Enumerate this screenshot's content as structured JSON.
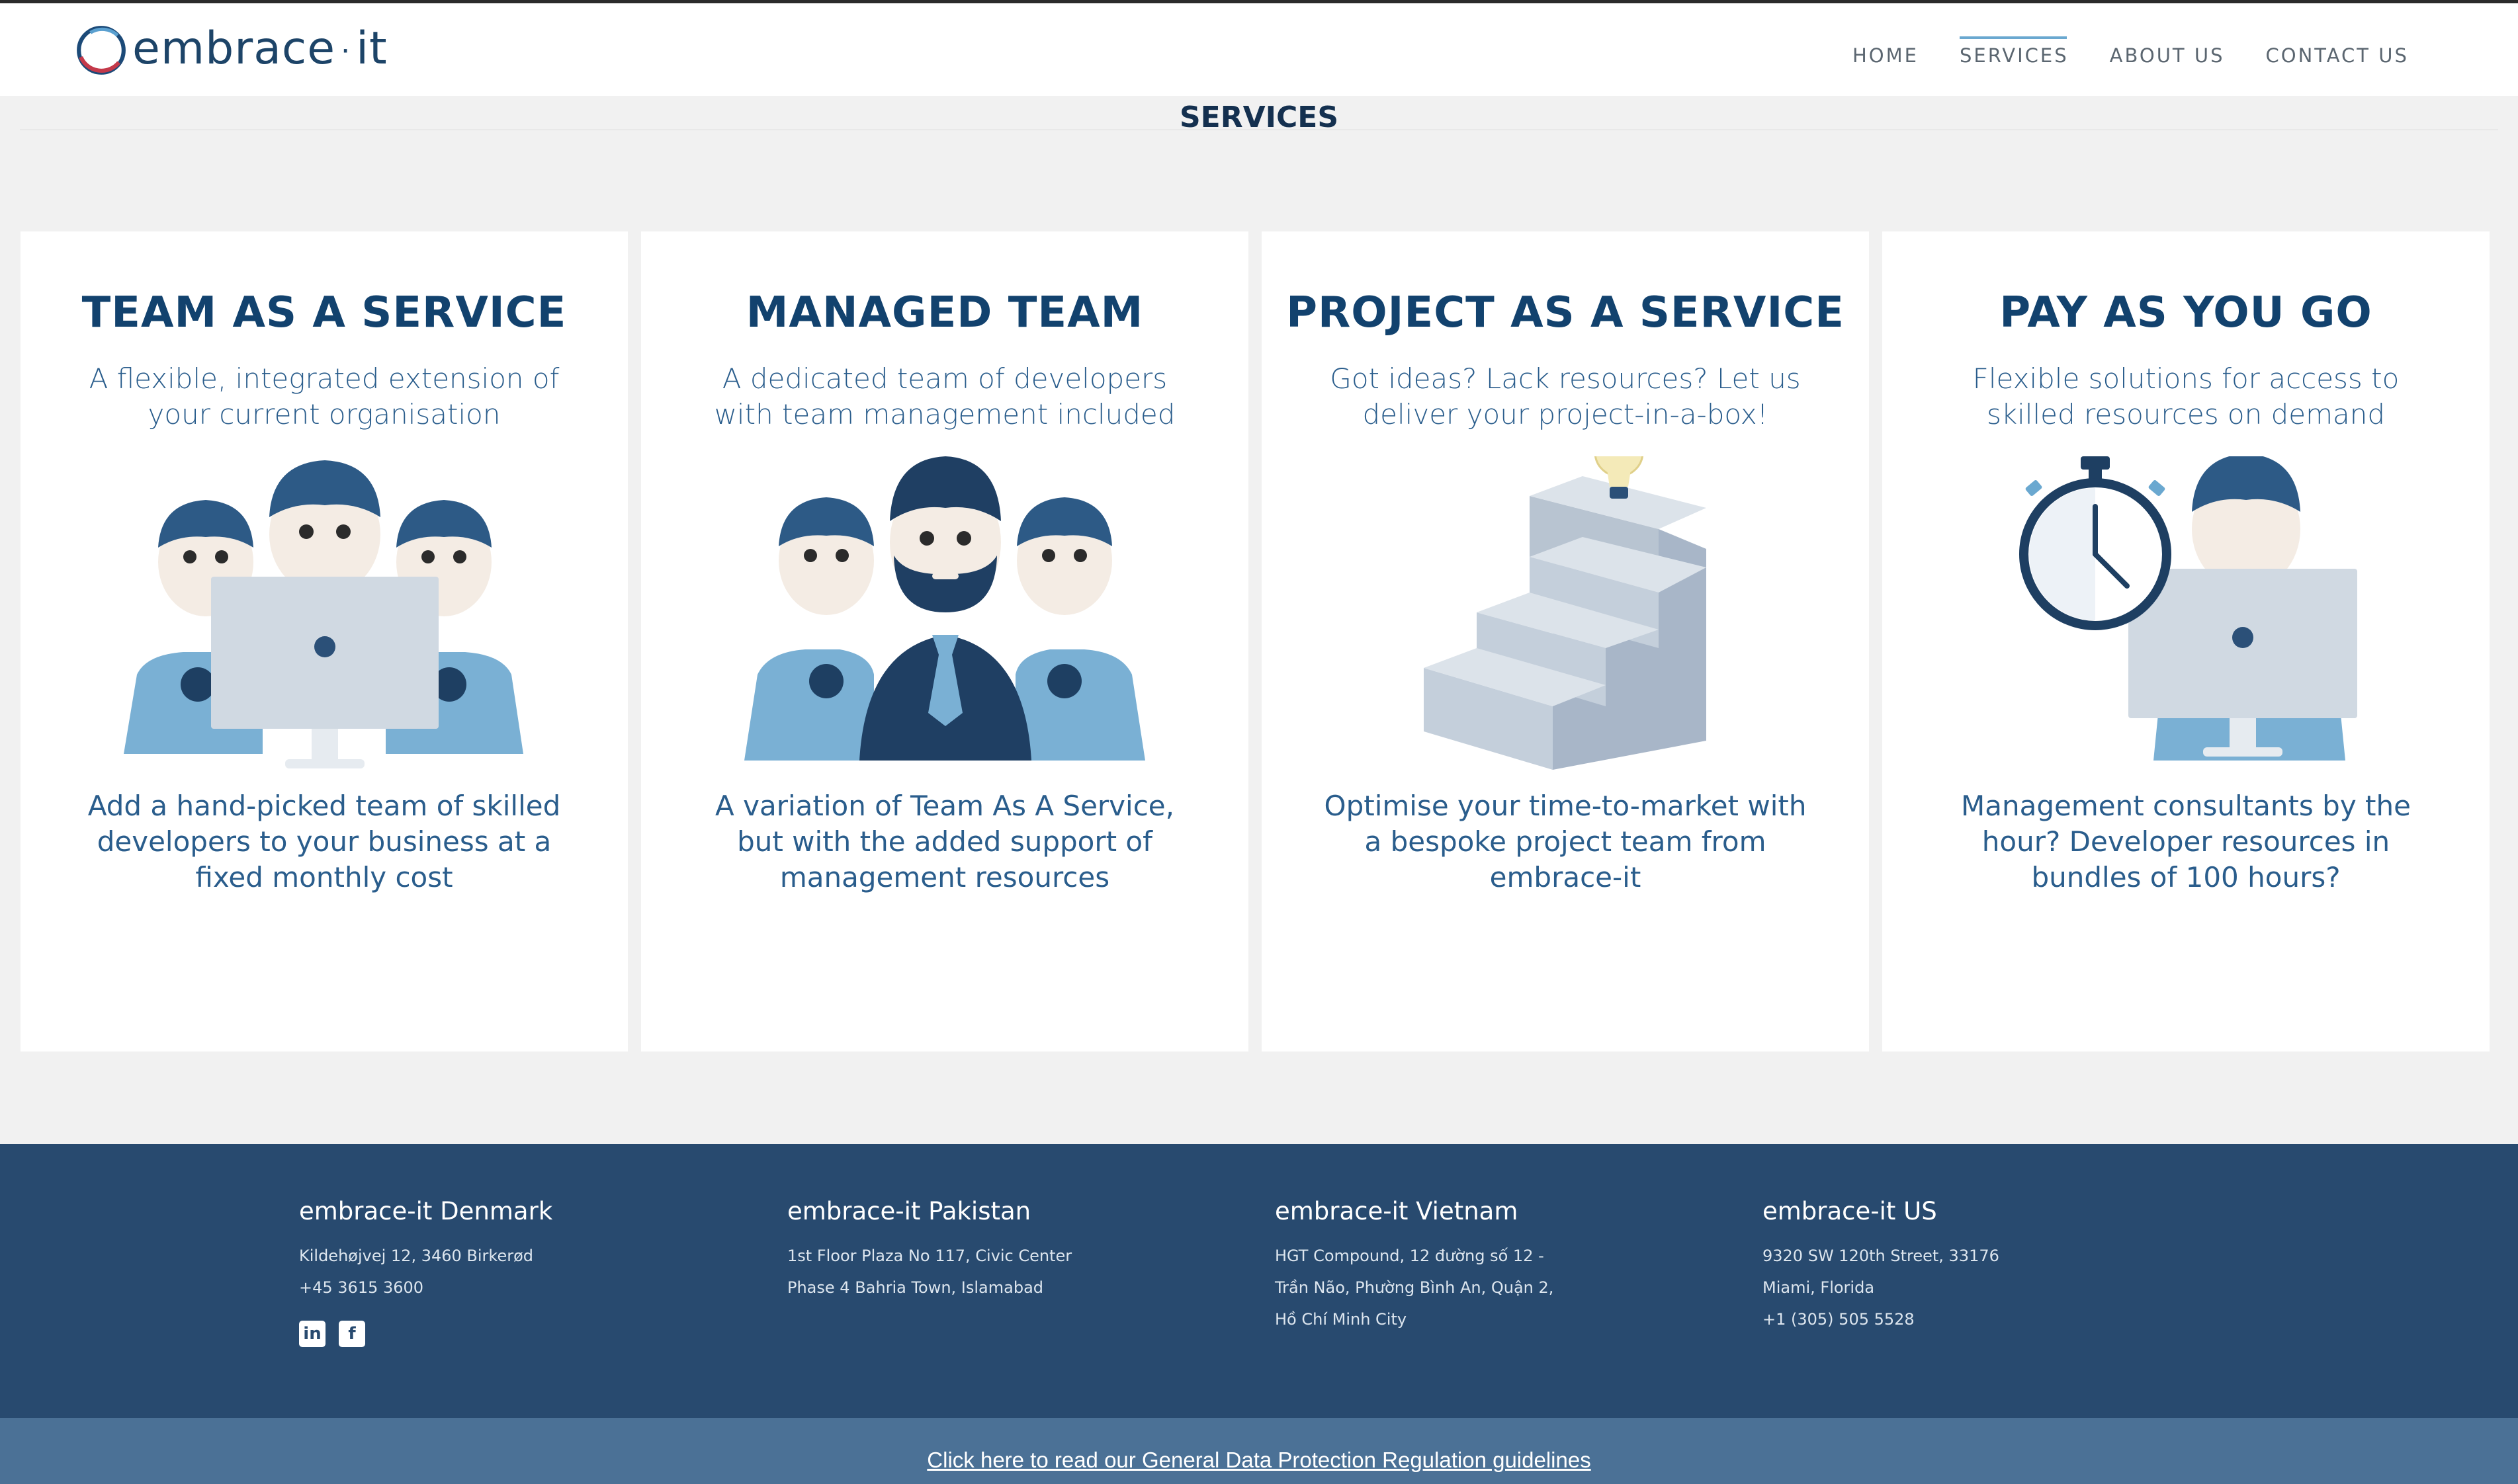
{
  "brand": {
    "name": "embrace",
    "separator": "·",
    "suffix": "it"
  },
  "nav": [
    {
      "label": "HOME"
    },
    {
      "label": "SERVICES",
      "active": true
    },
    {
      "label": "ABOUT US"
    },
    {
      "label": "CONTACT US"
    }
  ],
  "page": {
    "title": "SERVICES"
  },
  "cards": [
    {
      "title": "TEAM AS A SERVICE",
      "subtitle": "A flexible, integrated extension of your current organisation",
      "description": "Add a hand-picked team of skilled developers to your business at a fixed monthly cost",
      "illustration": "three-developers-laptop-icon"
    },
    {
      "title": "MANAGED TEAM",
      "subtitle": "A dedicated team of developers with team management included",
      "description": "A variation of Team As A Service, but with the added support of management resources",
      "illustration": "manager-with-developers-icon"
    },
    {
      "title": "PROJECT AS A SERVICE",
      "subtitle": "Got ideas? Lack resources? Let us deliver your project-in-a-box!",
      "description": "Optimise your time-to-market with a bespoke project team from embrace-it",
      "illustration": "stairs-lightbulb-icon"
    },
    {
      "title": "PAY AS YOU GO",
      "subtitle": "Flexible solutions for access to skilled resources on demand",
      "description": "Management consultants by the hour? Developer resources in bundles of 100 hours?",
      "illustration": "stopwatch-developer-icon"
    }
  ],
  "footer": {
    "offices": [
      {
        "name": "embrace-it Denmark",
        "lines": [
          "Kildehøjvej 12, 3460 Birkerød",
          "+45 3615 3600"
        ]
      },
      {
        "name": "embrace-it Pakistan",
        "lines": [
          "1st Floor Plaza No 117, Civic Center",
          "Phase 4 Bahria Town, Islamabad"
        ]
      },
      {
        "name": "embrace-it Vietnam",
        "lines": [
          "HGT Compound, 12 đường số 12 -",
          "Trần Não, Phường Bình An, Quận 2,",
          "Hồ Chí Minh City"
        ]
      },
      {
        "name": "embrace-it US",
        "lines": [
          "9320 SW 120th Street, 33176",
          "Miami, Florida",
          "+1 (305) 505 5528"
        ]
      }
    ],
    "social": [
      {
        "label": "in",
        "icon": "linkedin-icon"
      },
      {
        "label": "f",
        "icon": "facebook-icon"
      }
    ],
    "gdpr_link": "Click here to read our General Data Protection Regulation guidelines"
  },
  "colors": {
    "title_blue": "#12426e",
    "text_blue": "#2a5d8c",
    "footer_bg": "#284a6f",
    "gdpr_bg": "#4b7196",
    "nav_accent": "#6aa8d0"
  }
}
